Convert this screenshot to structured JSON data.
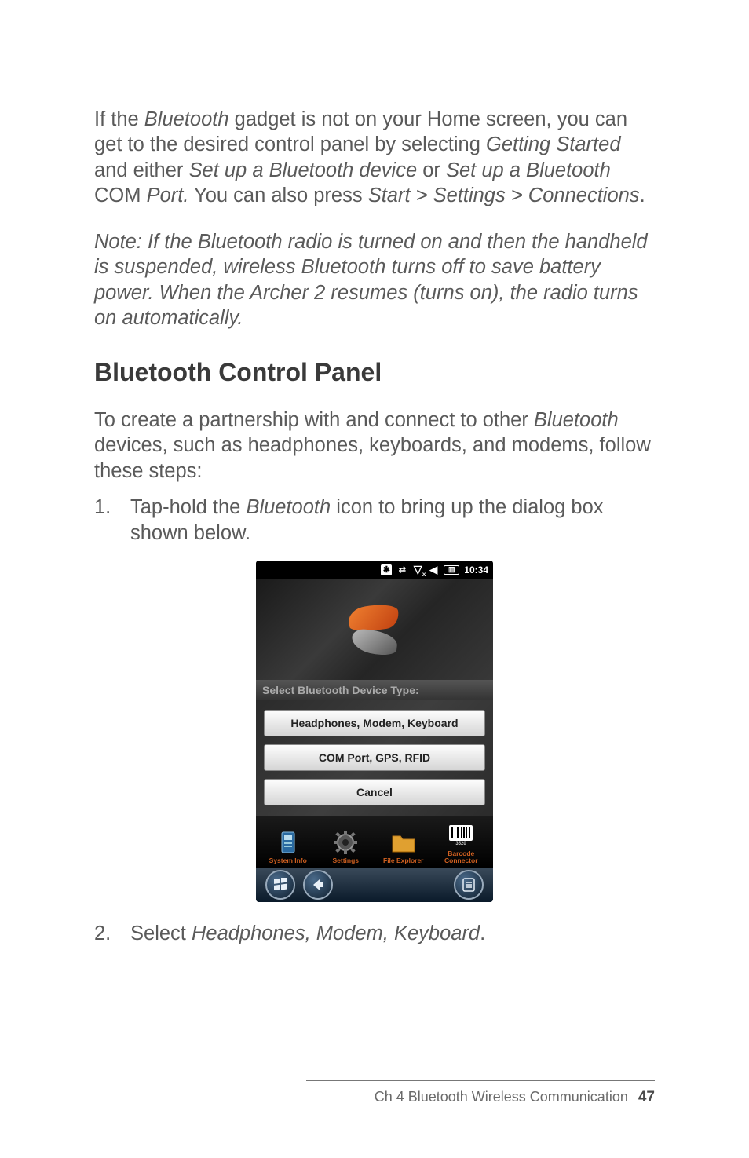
{
  "body": {
    "p1_a": "If the ",
    "p1_b": "Bluetooth",
    "p1_c": " gadget is not on your Home screen, you can get to the desired control panel by selecting ",
    "p1_d": "Getting Started",
    "p1_e": " and either ",
    "p1_f": "Set up a Bluetooth device",
    "p1_g": " or ",
    "p1_h": "Set up a Bluetooth",
    "p1_i": " COM ",
    "p1_j": "Port.",
    "p1_k": " You can also press ",
    "p1_l": "Start > Settings > Connections",
    "p1_m": ".",
    "note": "Note: If the Bluetooth radio is turned on and then the handheld is suspended, wireless Bluetooth turns off to save battery power. When the Archer 2 resumes (turns on), the radio turns on automatically.",
    "h2": "Bluetooth Control Panel",
    "p2_a": "To create a partnership with and connect to other ",
    "p2_b": "Bluetooth",
    "p2_c": " devices, such as headphones, keyboards, and modems, follow these steps:",
    "step1_num": "1.",
    "step1_a": "Tap-hold the ",
    "step1_b": "Bluetooth",
    "step1_c": " icon to bring up the dialog box shown below.",
    "step2_num": "2.",
    "step2_a": "Select ",
    "step2_b": "Headphones, Modem, Keyboard",
    "step2_c": "."
  },
  "device": {
    "status": {
      "time": "10:34",
      "bt_glyph": "✱",
      "conn_glyph": "⇄",
      "signal_glyph": "▽",
      "vol_glyph": "◀",
      "batt_glyph": "▥"
    },
    "select_label": "Select Bluetooth Device Type:",
    "buttons": {
      "hmk": "Headphones, Modem, Keyboard",
      "com": "COM Port, GPS, RFID",
      "cancel": "Cancel"
    },
    "dock": {
      "sysinfo": "System Info",
      "settings": "Settings",
      "fileexp": "File Explorer",
      "barcode_l1": "Barcode",
      "barcode_l2": "Connector"
    },
    "soft": {
      "start": "⊞",
      "back": "←",
      "menu": "≡"
    }
  },
  "footer": {
    "chapter": "Ch 4   Bluetooth Wireless Communication",
    "page": "47"
  }
}
